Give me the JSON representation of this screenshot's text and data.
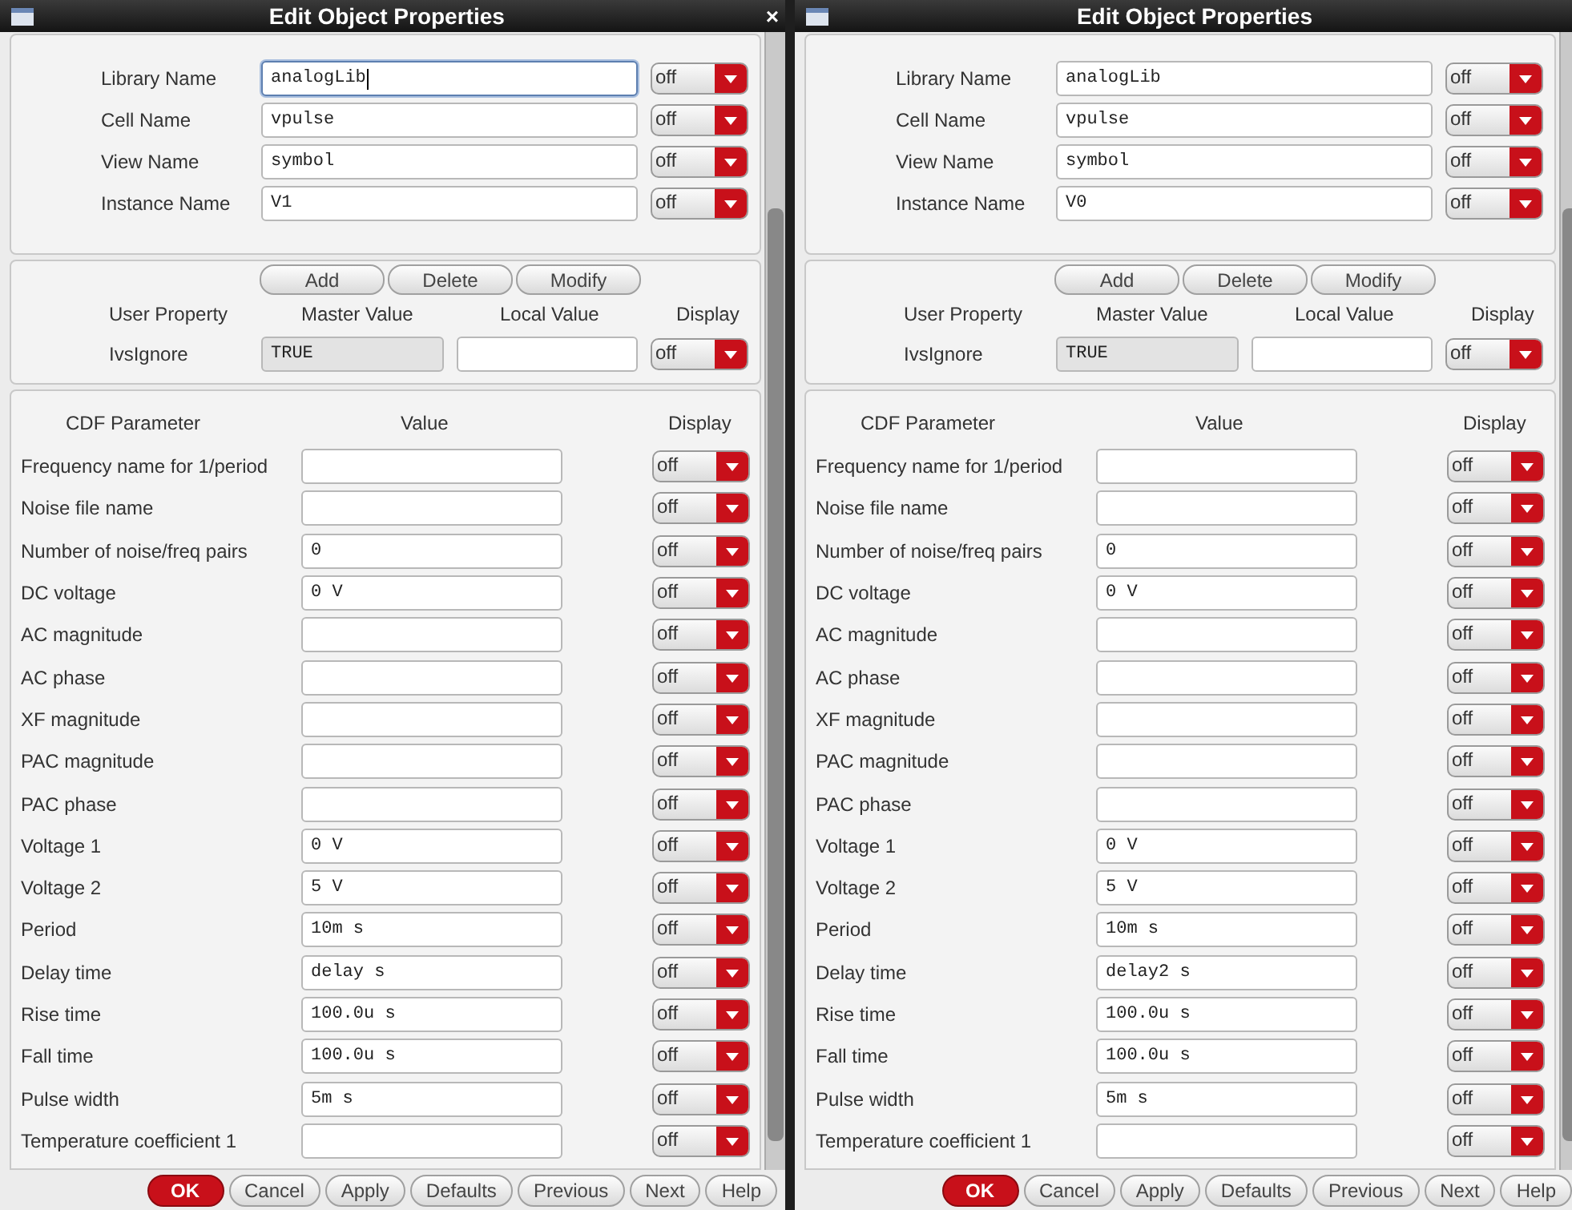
{
  "windows": [
    {
      "title": "Edit Object Properties",
      "close": "×",
      "properties": [
        {
          "label": "Library Name",
          "value": "analogLib",
          "focused": true,
          "display": "off"
        },
        {
          "label": "Cell Name",
          "value": "vpulse",
          "focused": false,
          "display": "off"
        },
        {
          "label": "View Name",
          "value": "symbol",
          "focused": false,
          "display": "off"
        },
        {
          "label": "Instance Name",
          "value": "V1",
          "focused": false,
          "display": "off"
        }
      ],
      "user_buttons": [
        "Add",
        "Delete",
        "Modify"
      ],
      "user_columns": [
        "User Property",
        "Master Value",
        "Local Value",
        "Display"
      ],
      "user_properties": [
        {
          "name": "IvsIgnore",
          "master_value": "TRUE",
          "display": "off"
        }
      ],
      "cdf_columns": [
        "CDF Parameter",
        "Value",
        "Display"
      ],
      "cdf_parameters": [
        {
          "label": "Frequency name for 1/period",
          "display": "off"
        },
        {
          "label": "Noise file name",
          "display": "off"
        },
        {
          "label": "Number of noise/freq pairs",
          "value": "0",
          "display": "off"
        },
        {
          "label": "DC voltage",
          "value": "0 V",
          "display": "off"
        },
        {
          "label": "AC magnitude",
          "display": "off"
        },
        {
          "label": "AC phase",
          "display": "off"
        },
        {
          "label": "XF magnitude",
          "display": "off"
        },
        {
          "label": "PAC magnitude",
          "display": "off"
        },
        {
          "label": "PAC phase",
          "display": "off"
        },
        {
          "label": "Voltage 1",
          "value": "0 V",
          "display": "off"
        },
        {
          "label": "Voltage 2",
          "value": "5 V",
          "display": "off"
        },
        {
          "label": "Period",
          "value": "10m s",
          "display": "off"
        },
        {
          "label": "Delay time",
          "value": "delay s",
          "display": "off"
        },
        {
          "label": "Rise time",
          "value": "100.0u s",
          "display": "off"
        },
        {
          "label": "Fall time",
          "value": "100.0u s",
          "display": "off"
        },
        {
          "label": "Pulse width",
          "value": "5m s",
          "display": "off"
        },
        {
          "label": "Temperature coefficient 1",
          "display": "off"
        }
      ],
      "buttons": [
        {
          "label": "OK",
          "kind": "primary"
        },
        {
          "label": "Cancel",
          "kind": "normal"
        },
        {
          "label": "Apply",
          "kind": "normal"
        },
        {
          "label": "Defaults",
          "kind": "normal"
        },
        {
          "label": "Previous",
          "kind": "normal"
        },
        {
          "label": "Next",
          "kind": "normal"
        },
        {
          "label": "Help",
          "kind": "normal"
        }
      ]
    },
    {
      "title": "Edit Object Properties",
      "properties": [
        {
          "label": "Library Name",
          "value": "analogLib",
          "focused": false,
          "display": "off"
        },
        {
          "label": "Cell Name",
          "value": "vpulse",
          "focused": false,
          "display": "off"
        },
        {
          "label": "View Name",
          "value": "symbol",
          "focused": false,
          "display": "off"
        },
        {
          "label": "Instance Name",
          "value": "V0",
          "focused": false,
          "display": "off"
        }
      ],
      "user_buttons": [
        "Add",
        "Delete",
        "Modify"
      ],
      "user_columns": [
        "User Property",
        "Master Value",
        "Local Value",
        "Display"
      ],
      "user_properties": [
        {
          "name": "IvsIgnore",
          "master_value": "TRUE",
          "display": "off"
        }
      ],
      "cdf_columns": [
        "CDF Parameter",
        "Value",
        "Display"
      ],
      "cdf_parameters": [
        {
          "label": "Frequency name for 1/period",
          "display": "off"
        },
        {
          "label": "Noise file name",
          "display": "off"
        },
        {
          "label": "Number of noise/freq pairs",
          "value": "0",
          "display": "off"
        },
        {
          "label": "DC voltage",
          "value": "0 V",
          "display": "off"
        },
        {
          "label": "AC magnitude",
          "display": "off"
        },
        {
          "label": "AC phase",
          "display": "off"
        },
        {
          "label": "XF magnitude",
          "display": "off"
        },
        {
          "label": "PAC magnitude",
          "display": "off"
        },
        {
          "label": "PAC phase",
          "display": "off"
        },
        {
          "label": "Voltage 1",
          "value": "0 V",
          "display": "off"
        },
        {
          "label": "Voltage 2",
          "value": "5 V",
          "display": "off"
        },
        {
          "label": "Period",
          "value": "10m s",
          "display": "off"
        },
        {
          "label": "Delay time",
          "value": "delay2 s",
          "display": "off"
        },
        {
          "label": "Rise time",
          "value": "100.0u s",
          "display": "off"
        },
        {
          "label": "Fall time",
          "value": "100.0u s",
          "display": "off"
        },
        {
          "label": "Pulse width",
          "value": "5m s",
          "display": "off"
        },
        {
          "label": "Temperature coefficient 1",
          "display": "off"
        }
      ],
      "buttons": [
        {
          "label": "OK",
          "kind": "primary"
        },
        {
          "label": "Cancel",
          "kind": "normal"
        },
        {
          "label": "Apply",
          "kind": "normal"
        },
        {
          "label": "Defaults",
          "kind": "normal"
        },
        {
          "label": "Previous",
          "kind": "normal"
        },
        {
          "label": "Next",
          "kind": "normal"
        },
        {
          "label": "Help",
          "kind": "normal"
        }
      ]
    }
  ]
}
